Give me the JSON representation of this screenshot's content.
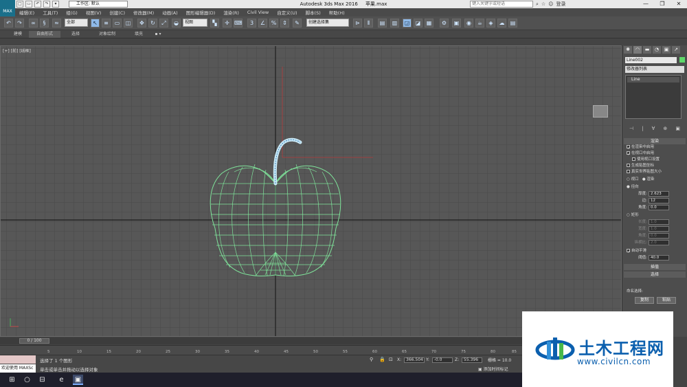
{
  "titlebar": {
    "logo_text": "MAX",
    "quick_access": [
      "□",
      "▭",
      "↶",
      "↷",
      "▾"
    ],
    "workspace": "工作区: 默认",
    "app_name": "Autodesk 3ds Max 2016",
    "file_name": "苹果.max",
    "search_placeholder": "键入关键字或短语",
    "login_label": "登录",
    "window_controls": [
      "—",
      "❐",
      "✕"
    ]
  },
  "menu": [
    "编辑(E)",
    "工具(T)",
    "组(G)",
    "视图(V)",
    "创建(C)",
    "修改器(M)",
    "动画(A)",
    "图形编辑器(D)",
    "渲染(R)",
    "Civil View",
    "自定义(U)",
    "脚本(S)",
    "帮助(H)"
  ],
  "toolbar": {
    "selection_filter": "全部",
    "ref_coord": "视图",
    "named_selection": "创建选择集"
  },
  "ribbon": {
    "tabs": [
      "建模",
      "自由形式",
      "选择",
      "对象绘制",
      "填充",
      "▪ ▾"
    ]
  },
  "viewport": {
    "label": "[+] [前] [线框]"
  },
  "command_panel": {
    "tabs": [
      "✺",
      "◠",
      "▬",
      "◔",
      "▣",
      "↗"
    ],
    "object_name": "Line002",
    "object_color": "#5fd86a",
    "modifier_list": "修改器列表",
    "stack_item": "Line",
    "stack_icons": [
      "⊣",
      "|",
      "∀",
      "⊕",
      "▣"
    ],
    "render_rollout": {
      "title": "渲染",
      "options": [
        {
          "label": "在渲染中启用",
          "checked": true
        },
        {
          "label": "在视口中启用",
          "checked": true
        },
        {
          "label": "使用视口设置",
          "checked": false,
          "sub": true
        },
        {
          "label": "生成贴图坐标",
          "checked": false
        },
        {
          "label": "真实世界贴图大小",
          "checked": false
        }
      ],
      "mode": {
        "viewport": "视口",
        "render": "渲染"
      },
      "radial_label": "径向",
      "radial": [
        {
          "label": "厚度:",
          "value": "2.623"
        },
        {
          "label": "边:",
          "value": "12"
        },
        {
          "label": "角度:",
          "value": "0.0"
        }
      ],
      "rect_label": "矩形",
      "rect": [
        {
          "label": "长度:",
          "value": "1.0"
        },
        {
          "label": "宽度:",
          "value": "1.0"
        },
        {
          "label": "角度:",
          "value": "0.0"
        },
        {
          "label": "纵横比:",
          "value": "2.0"
        }
      ],
      "auto_smooth": "自动平滑",
      "threshold_label": "阈值:",
      "threshold_value": "40.0"
    },
    "interp_title": "插值",
    "select_title": "选择",
    "named_sel_title": "命名选择:",
    "copy_btn": "复制",
    "paste_btn": "粘贴"
  },
  "timeline": {
    "slider_label": "0 / 100",
    "ticks": [
      "0",
      "5",
      "10",
      "15",
      "20",
      "25",
      "30",
      "35",
      "40",
      "45",
      "50",
      "55",
      "60",
      "65",
      "70",
      "75",
      "80",
      "85",
      "90"
    ]
  },
  "status": {
    "maxscript_welcome": "欢迎使用 MAXSc",
    "message": "选择了 1 个图形",
    "prompt": "单击或单击并拖动以选择对象",
    "x_value": "366.504",
    "y_value": "-0.0",
    "z_value": "55.396",
    "grid": "栅格 = 10.0",
    "add_tag": "添加时间标记"
  },
  "watermark": {
    "name": "土木工程网",
    "url": "www.civilcn.com"
  },
  "taskbar": {
    "icons": [
      "⊞",
      "○",
      "⊟",
      "e",
      "▣"
    ]
  }
}
